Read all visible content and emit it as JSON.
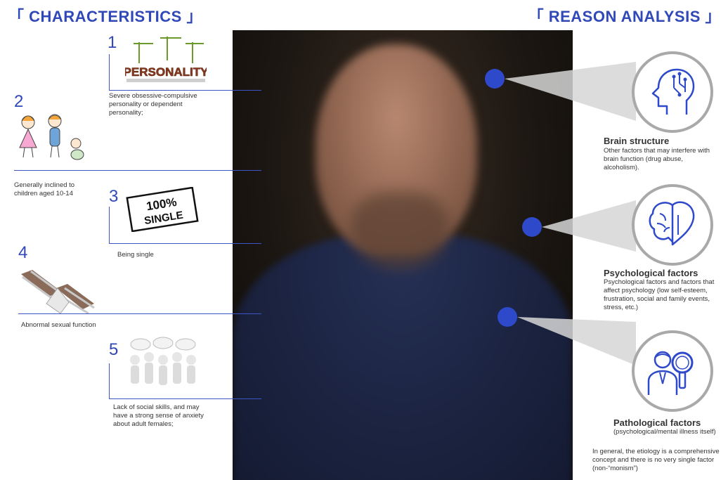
{
  "headers": {
    "left": "「 CHARACTERISTICS 」",
    "right": "「 REASON ANALYSIS 」"
  },
  "characteristics": [
    {
      "number": "1",
      "image_text": "PERSONALITY",
      "description": "Severe obsessive-compulsive personality or dependent personality;"
    },
    {
      "number": "2",
      "description": "Generally inclined to children aged 10-14"
    },
    {
      "number": "3",
      "image_text": [
        "100%",
        "SINGLE"
      ],
      "description": "Being single"
    },
    {
      "number": "4",
      "description": "Abnormal sexual function"
    },
    {
      "number": "5",
      "description": "Lack of social skills, and may have a strong sense of anxiety about adult females;"
    }
  ],
  "reasons": [
    {
      "title": "Brain structure",
      "icon": "brain-circuit-head-icon",
      "text": "Other factors that may interfere with brain function (drug abuse, alcoholism)."
    },
    {
      "title": "Psychological factors",
      "icon": "brain-heart-icon",
      "text": "Psychological factors and factors that affect psychology (low self-esteem, frustration, social and family events, stress, etc.)"
    },
    {
      "title": "Pathological factors",
      "icon": "doctor-magnifier-icon",
      "text": "(psychological/mental illness itself)"
    }
  ],
  "conclusion": "In general, the etiology is a comprehensive concept and there is no very single factor (non-“monism”)",
  "colors": {
    "accent": "#3048b8",
    "dot": "#2e49c9",
    "circle_border": "#a9a9a9"
  }
}
